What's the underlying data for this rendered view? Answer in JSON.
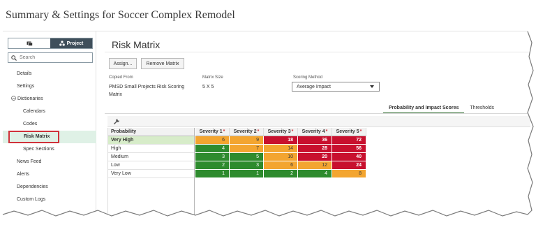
{
  "page": {
    "title": "Summary & Settings for Soccer Complex Remodel"
  },
  "sidebar": {
    "toggle": {
      "left_label": "",
      "right_label": "Project"
    },
    "search": {
      "placeholder": "Search"
    },
    "items": [
      {
        "label": "Details",
        "kind": "item"
      },
      {
        "label": "Settings",
        "kind": "item"
      },
      {
        "label": "Dictionaries",
        "kind": "group"
      },
      {
        "label": "Calendars",
        "kind": "sub"
      },
      {
        "label": "Codes",
        "kind": "sub"
      },
      {
        "label": "Risk Matrix",
        "kind": "sub",
        "active": true
      },
      {
        "label": "Spec Sections",
        "kind": "sub"
      },
      {
        "label": "News Feed",
        "kind": "item"
      },
      {
        "label": "Alerts",
        "kind": "item"
      },
      {
        "label": "Dependencies",
        "kind": "item"
      },
      {
        "label": "Custom Logs",
        "kind": "item"
      }
    ]
  },
  "main": {
    "title": "Risk Matrix",
    "buttons": {
      "assign": "Assign...",
      "remove": "Remove Matrix"
    },
    "copied_from": {
      "label": "Copied From",
      "value": "PMSD Small Projects Risk Scoring Matrix"
    },
    "matrix_size": {
      "label": "Matrix Size",
      "value": "5 X 5"
    },
    "scoring_method": {
      "label": "Scoring Method",
      "value": "Average Impact"
    },
    "tabs": [
      "Probability and Impact Scores",
      "Thresholds"
    ],
    "matrix": {
      "row_header": "Probability",
      "columns": [
        "Severity 1",
        "Severity 2",
        "Severity 3",
        "Severity 4",
        "Severity 5"
      ],
      "rows": [
        {
          "label": "Very High",
          "selected": true,
          "cells": [
            {
              "v": "6",
              "c": "orange"
            },
            {
              "v": "9",
              "c": "orange"
            },
            {
              "v": "18",
              "c": "red"
            },
            {
              "v": "36",
              "c": "red"
            },
            {
              "v": "72",
              "c": "red"
            }
          ]
        },
        {
          "label": "High",
          "cells": [
            {
              "v": "4",
              "c": "green"
            },
            {
              "v": "7",
              "c": "orange"
            },
            {
              "v": "14",
              "c": "orange"
            },
            {
              "v": "28",
              "c": "red"
            },
            {
              "v": "56",
              "c": "red"
            }
          ]
        },
        {
          "label": "Medium",
          "cells": [
            {
              "v": "3",
              "c": "green"
            },
            {
              "v": "5",
              "c": "green"
            },
            {
              "v": "10",
              "c": "orange"
            },
            {
              "v": "20",
              "c": "red"
            },
            {
              "v": "40",
              "c": "red"
            }
          ]
        },
        {
          "label": "Low",
          "cells": [
            {
              "v": "2",
              "c": "green"
            },
            {
              "v": "3",
              "c": "green"
            },
            {
              "v": "6",
              "c": "orange"
            },
            {
              "v": "12",
              "c": "orange"
            },
            {
              "v": "24",
              "c": "red"
            }
          ]
        },
        {
          "label": "Very Low",
          "cells": [
            {
              "v": "1",
              "c": "green"
            },
            {
              "v": "1",
              "c": "green"
            },
            {
              "v": "2",
              "c": "green"
            },
            {
              "v": "4",
              "c": "green"
            },
            {
              "v": "8",
              "c": "orange"
            }
          ]
        }
      ]
    }
  },
  "colors": {
    "red": "#c8102e",
    "orange": "#f3a530",
    "green": "#2e8b2e",
    "selected_row": "#d7ecc9",
    "active_nav": "#dff1e6",
    "highlight_box": "#d0323a"
  },
  "icons": {
    "toggle_left": "desktop-icon",
    "toggle_right": "project-icon",
    "search": "search-icon",
    "toolbar": "wrench-icon",
    "dropdown": "chevron-down-icon"
  }
}
